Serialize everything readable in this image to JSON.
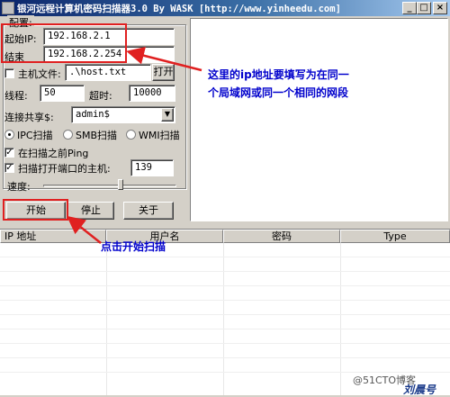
{
  "window": {
    "title": "银河远程计算机密码扫描器3.0 By WASK [http://www.yinheedu.com]",
    "minimize": "_",
    "maximize": "□",
    "close": "×"
  },
  "config": {
    "group_label": "配置:",
    "start_ip_label": "起始IP:",
    "start_ip": "192.168.2.1",
    "end_label": "结束",
    "end_ip": "192.168.2.254",
    "host_file_label": "主机文件:",
    "host_file": ".\\host.txt",
    "open_button": "打开",
    "threads_label": "线程:",
    "threads": "50",
    "timeout_label": "超时:",
    "timeout": "10000",
    "share_label": "连接共享$:",
    "share_value": "admin$",
    "ipc_label": "IPC扫描",
    "smb_label": "SMB扫描",
    "wmi_label": "WMI扫描",
    "ping_label": "在扫描之前Ping",
    "port_label": "扫描打开端口的主机:",
    "port": "139",
    "speed_label": "速度:",
    "speed_fraction": 0.58
  },
  "buttons": {
    "start": "开始",
    "stop": "停止",
    "about": "关于"
  },
  "table": {
    "columns": [
      "IP 地址",
      "用户名",
      "密码",
      "Type"
    ]
  },
  "annotations": {
    "ip_note_line1": "这里的ip地址要填写为在同一",
    "ip_note_line2": "个局域网或同一个相同的网段",
    "start_note": "点击开始扫描"
  },
  "watermark": {
    "site": "@51CTO博客",
    "author": "刘晨号"
  },
  "colors": {
    "annotation": "#0000cc",
    "highlight": "#e02020",
    "titlebar": "#0a246a"
  }
}
